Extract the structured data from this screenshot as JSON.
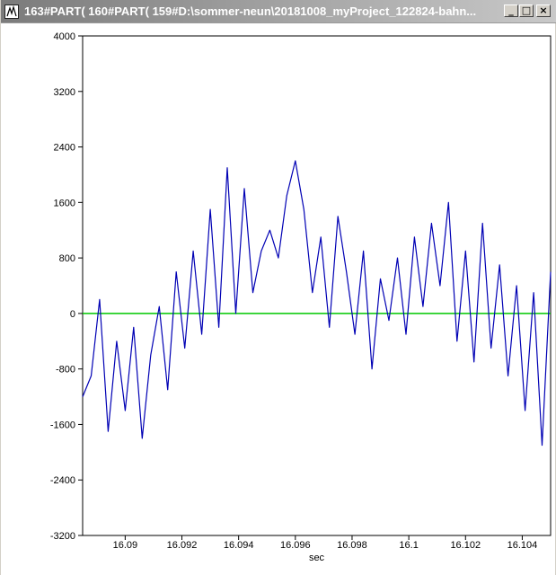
{
  "window": {
    "title": "163#PART( 160#PART( 159#D:\\sommer-neun\\20181008_myProject_122824-bahn...",
    "minimize_label": "_",
    "maximize_label": "□",
    "close_label": "×"
  },
  "colors": {
    "signal": "#0000b4",
    "zero_line": "#00c800",
    "title_bar": "#7b7b7b"
  },
  "chart_data": {
    "type": "line",
    "title": "",
    "xlabel": "sec",
    "ylabel": "",
    "xlim": [
      16.0885,
      16.105
    ],
    "ylim": [
      -3200,
      4000
    ],
    "x_ticks": [
      16.09,
      16.092,
      16.094,
      16.096,
      16.098,
      16.1,
      16.102,
      16.104
    ],
    "x_tick_labels": [
      "16.09",
      "16.092",
      "16.094",
      "16.096",
      "16.098",
      "16.1",
      "16.102",
      "16.104"
    ],
    "y_ticks": [
      4000,
      3200,
      2400,
      1600,
      800,
      0,
      -800,
      -1600,
      -2400,
      -3200
    ],
    "y_tick_labels": [
      "4000",
      "3200",
      "2400",
      "1600",
      "800",
      "0",
      "-800",
      "-1600",
      "-2400",
      "-3200"
    ],
    "grid": false,
    "reference_line_y": 0,
    "series": [
      {
        "x": [
          16.0885,
          16.0888,
          16.0891,
          16.0894,
          16.0897,
          16.09,
          16.0903,
          16.0906,
          16.0909,
          16.0912,
          16.0915,
          16.0918,
          16.0921,
          16.0924,
          16.0927,
          16.093,
          16.0933,
          16.0936,
          16.0939,
          16.0942,
          16.0945,
          16.0948,
          16.0951,
          16.0954,
          16.0957,
          16.096,
          16.0963,
          16.0966,
          16.0969,
          16.0972,
          16.0975,
          16.0978,
          16.0981,
          16.0984,
          16.0987,
          16.099,
          16.0993,
          16.0996,
          16.0999,
          16.1002,
          16.1005,
          16.1008,
          16.1011,
          16.1014,
          16.1017,
          16.102,
          16.1023,
          16.1026,
          16.1029,
          16.1032,
          16.1035,
          16.1038,
          16.1041,
          16.1044,
          16.1047,
          16.105
        ],
        "values": [
          -1200,
          -900,
          200,
          -1700,
          -400,
          -1400,
          -200,
          -1800,
          -600,
          100,
          -1100,
          600,
          -500,
          900,
          -300,
          1500,
          -200,
          2100,
          0,
          1800,
          300,
          900,
          1200,
          800,
          1700,
          2200,
          1500,
          300,
          1100,
          -200,
          1400,
          600,
          -300,
          900,
          -800,
          500,
          -100,
          800,
          -300,
          1100,
          100,
          1300,
          400,
          1600,
          -400,
          900,
          -700,
          1300,
          -500,
          700,
          -900,
          400,
          -1400,
          300,
          -1900,
          600
        ]
      }
    ]
  }
}
